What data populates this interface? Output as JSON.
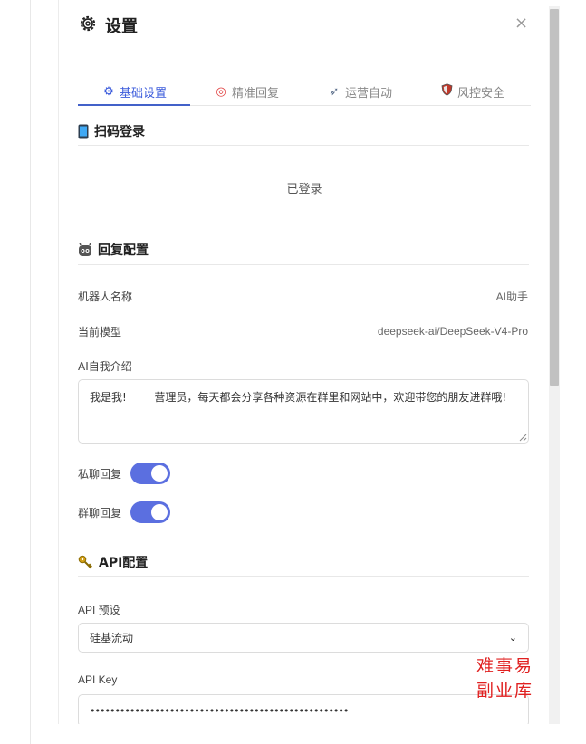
{
  "dialog": {
    "title": "设置",
    "close_label": "×"
  },
  "tabs": [
    {
      "label": "基础设置",
      "icon": "gear-icon",
      "active": true
    },
    {
      "label": "精准回复",
      "icon": "target-icon",
      "active": false
    },
    {
      "label": "运营自动",
      "icon": "rocket-icon",
      "active": false
    },
    {
      "label": "风控安全",
      "icon": "shield-icon",
      "active": false
    }
  ],
  "login": {
    "title": "扫码登录",
    "icon": "phone-icon",
    "status": "已登录"
  },
  "reply": {
    "title": "回复配置",
    "icon": "robot-icon",
    "bot_name_label": "机器人名称",
    "bot_name_value": "AI助手",
    "model_label": "当前模型",
    "model_value": "deepseek-ai/DeepSeek-V4-Pro",
    "intro_label": "AI自我介绍",
    "intro_value": "我是我!        营理员，每天都会分享各种资源在群里和网站中，欢迎带您的朋友进群哦!",
    "private_reply_label": "私聊回复",
    "private_reply_on": true,
    "group_reply_label": "群聊回复",
    "group_reply_on": true
  },
  "api": {
    "title": "API配置",
    "icon": "key-icon",
    "preset_label": "API 预设",
    "preset_value": "硅基流动",
    "key_label": "API Key",
    "key_value": "••••••••••••••••••••••••••••••••••••••••••••••••••••"
  },
  "watermark": "难事易副业库",
  "colors": {
    "accent": "#4361c9",
    "toggle_on": "#5b6fe0",
    "watermark": "#e02020"
  }
}
